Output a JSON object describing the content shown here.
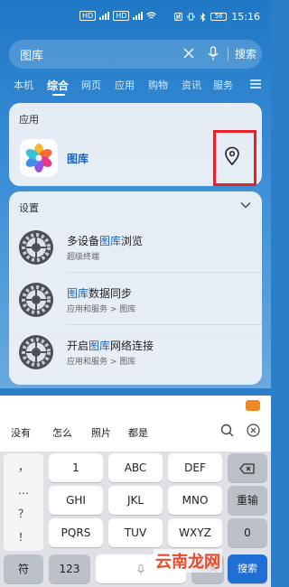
{
  "status": {
    "network_label": "HD",
    "network_label2": "HD",
    "time": "15:16",
    "battery": "56"
  },
  "search": {
    "value": "图库",
    "button": "搜索"
  },
  "tabs": [
    "本机",
    "综合",
    "网页",
    "应用",
    "购物",
    "资讯",
    "服务"
  ],
  "active_tab": "综合",
  "app_card": {
    "header": "应用",
    "app_name": "图库"
  },
  "settings_card": {
    "header": "设置",
    "items": [
      {
        "pre": "多设备",
        "hl": "图库",
        "post": "浏览",
        "sub": "超级终端"
      },
      {
        "pre": "",
        "hl": "图库",
        "post": "数据同步",
        "sub": "应用和服务 > 图库"
      },
      {
        "pre": "开启",
        "hl": "图库",
        "post": "网络连接",
        "sub": "应用和服务 > 图库"
      }
    ]
  },
  "suggestions": [
    "没有",
    "怎么",
    "照片",
    "都是"
  ],
  "keyboard": {
    "left_symbols": [
      "，",
      "…",
      "？",
      "！"
    ],
    "rows": [
      [
        "1",
        "ABC",
        "DEF"
      ],
      [
        "GHI",
        "JKL",
        "MNO"
      ],
      [
        "PQRS",
        "TUV",
        "WXYZ"
      ]
    ],
    "right_keys": [
      "删除",
      "重输",
      "0"
    ],
    "bottom": {
      "symbols": "符",
      "numbers": "123",
      "space": "",
      "lang": "中/英",
      "go": "搜索"
    }
  },
  "watermark": "云南龙网",
  "colors": {
    "accent": "#1765c2",
    "highlight_box": "#e82027"
  }
}
